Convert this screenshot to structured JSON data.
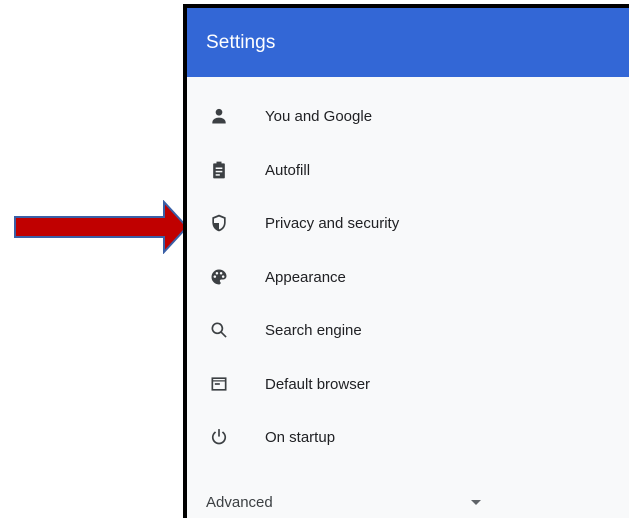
{
  "header": {
    "title": "Settings",
    "color": "#3367d6"
  },
  "menu": {
    "items": [
      {
        "label": "You and Google",
        "icon": "person-icon"
      },
      {
        "label": "Autofill",
        "icon": "clipboard-icon"
      },
      {
        "label": "Privacy and security",
        "icon": "shield-icon"
      },
      {
        "label": "Appearance",
        "icon": "palette-icon"
      },
      {
        "label": "Search engine",
        "icon": "search-icon"
      },
      {
        "label": "Default browser",
        "icon": "browser-window-icon"
      },
      {
        "label": "On startup",
        "icon": "power-icon"
      }
    ],
    "advanced_label": "Advanced"
  },
  "annotation": {
    "arrow_color": "#c00000",
    "arrow_target": "Privacy and security"
  }
}
